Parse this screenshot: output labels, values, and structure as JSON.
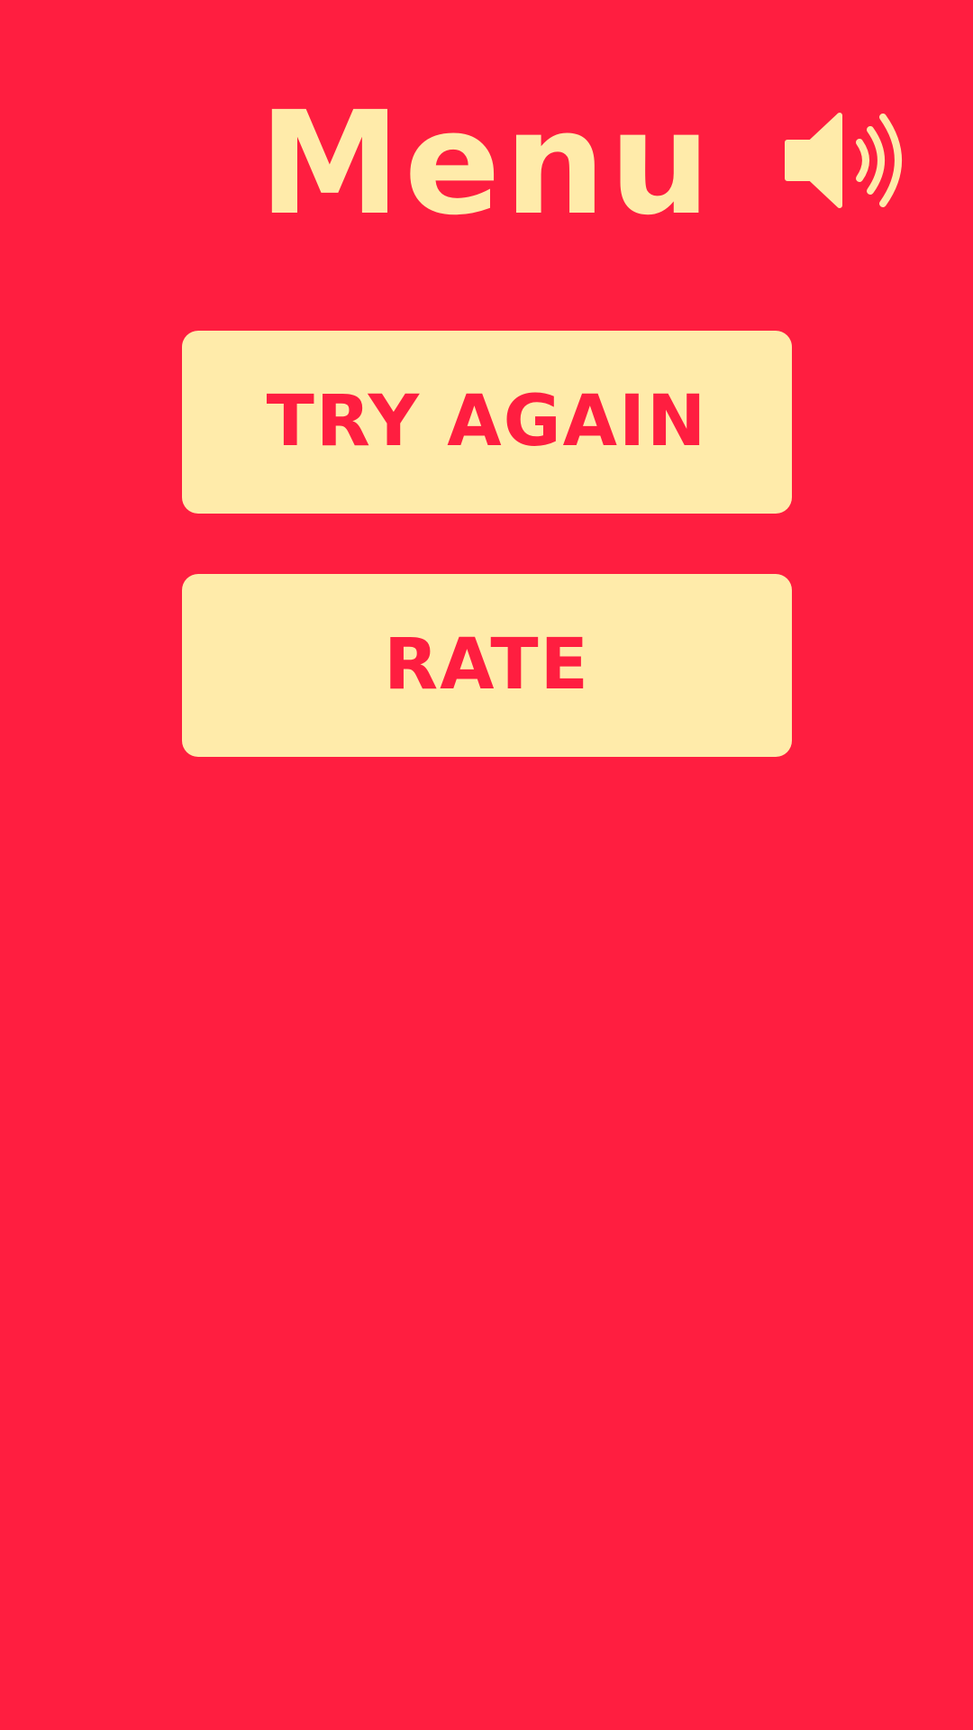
{
  "screen": {
    "title": "Menu",
    "sound_icon": "speaker-volume-icon"
  },
  "buttons": {
    "try_again_label": "TRY AGAIN",
    "rate_label": "RATE"
  },
  "colors": {
    "background": "#FF1E40",
    "accent": "#FFEBAA"
  }
}
